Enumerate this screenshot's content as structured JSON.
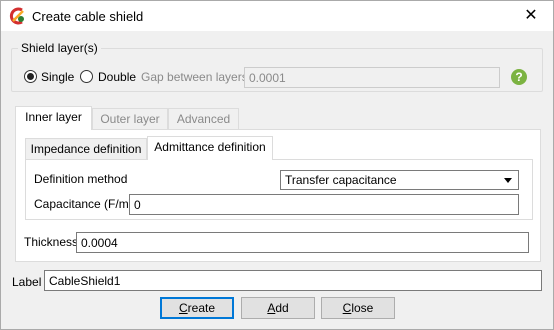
{
  "window": {
    "title": "Create cable shield",
    "close_glyph": "✕",
    "app_icon": "cst-app-icon"
  },
  "shield_layers": {
    "legend": "Shield layer(s)",
    "single_label": "Single",
    "double_label": "Double",
    "selected": "Single",
    "gap_label": "Gap between layers",
    "gap_value": "0.0001",
    "help_icon": "help-icon",
    "help_glyph": "?"
  },
  "layer_tabs": [
    {
      "label": "Inner layer",
      "active": true
    },
    {
      "label": "Outer layer",
      "active": false
    },
    {
      "label": "Advanced",
      "active": false
    }
  ],
  "definition_tabs": [
    {
      "label": "Impedance definition",
      "active": false
    },
    {
      "label": "Admittance definition",
      "active": true
    }
  ],
  "admittance": {
    "method_label": "Definition method",
    "method_value": "Transfer capacitance",
    "capacitance_label": "Capacitance (F/m)",
    "capacitance_value": "0"
  },
  "thickness": {
    "label": "Thickness",
    "value": "0.0004"
  },
  "label_field": {
    "label": "Label",
    "value": "CableShield1"
  },
  "buttons": {
    "create": {
      "mnemonic": "C",
      "rest": "reate"
    },
    "add": {
      "mnemonic": "A",
      "rest": "dd"
    },
    "close": {
      "mnemonic": "C",
      "rest": "lose"
    }
  },
  "colors": {
    "help_icon": "#7cb342",
    "default_button_border": "#0078d7"
  }
}
